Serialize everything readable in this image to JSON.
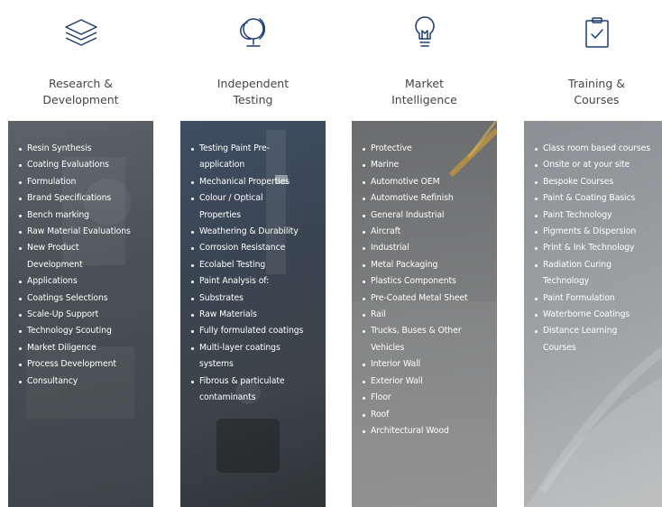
{
  "columns": [
    {
      "icon": "layers-icon",
      "title_line1": "Research &",
      "title_line2": "Development",
      "items": [
        [
          "Resin Synthesis"
        ],
        [
          "Coating Evaluations"
        ],
        [
          "Formulation"
        ],
        [
          "Brand Specifications"
        ],
        [
          "Bench marking"
        ],
        [
          "Raw Material Evaluations"
        ],
        [
          "New Product",
          "Development"
        ],
        [
          "Applications"
        ],
        [
          "Coatings Selections"
        ],
        [
          "Scale-Up Support"
        ],
        [
          "Technology Scouting"
        ],
        [
          "Market Diligence"
        ],
        [
          "Process Development"
        ],
        [
          "Consultancy"
        ]
      ]
    },
    {
      "icon": "globe-icon",
      "title_line1": "Independent",
      "title_line2": "Testing",
      "items": [
        [
          "Testing Paint Pre-",
          "application"
        ],
        [
          "Mechanical Properties"
        ],
        [
          "Colour / Optical",
          "Properties"
        ],
        [
          "Weathering & Durability"
        ],
        [
          "Corrosion Resistance"
        ],
        [
          "Ecolabel Testing"
        ],
        [
          "Paint Analysis of:"
        ],
        [
          "Substrates"
        ],
        [
          "Raw Materials"
        ],
        [
          "Fully formulated coatings"
        ],
        [
          "Multi-layer coatings",
          "systems"
        ],
        [
          "Fibrous & particulate",
          "contaminants"
        ]
      ]
    },
    {
      "icon": "lightbulb-icon",
      "title_line1": "Market",
      "title_line2": "Intelligence",
      "items": [
        [
          "Protective"
        ],
        [
          "Marine"
        ],
        [
          "Automotive OEM"
        ],
        [
          "Automotive Refinish"
        ],
        [
          "General Industrial"
        ],
        [
          "Aircraft"
        ],
        [
          "Industrial"
        ],
        [
          "Metal Packaging"
        ],
        [
          "Plastics Components"
        ],
        [
          "Pre-Coated Metal Sheet"
        ],
        [
          "Rail"
        ],
        [
          "Trucks, Buses & Other",
          "Vehicles"
        ],
        [
          "Interior Wall"
        ],
        [
          "Exterior Wall"
        ],
        [
          "Floor"
        ],
        [
          "Roof"
        ],
        [
          "Architectural Wood"
        ]
      ]
    },
    {
      "icon": "clipboard-check-icon",
      "title_line1": "Training &",
      "title_line2": "Courses",
      "items": [
        [
          "Class room based courses"
        ],
        [
          "Onsite or at your site"
        ],
        [
          "Bespoke Courses"
        ],
        [
          "Paint & Coating Basics"
        ],
        [
          "Paint Technology"
        ],
        [
          "Pigments & Dispersion"
        ],
        [
          "Print & Ink Technology"
        ],
        [
          "Radiation Curing",
          "Technology"
        ],
        [
          "Paint Formulation"
        ],
        [
          "Waterborne Coatings"
        ],
        [
          "Distance Learning",
          "Courses"
        ]
      ]
    }
  ],
  "colors": {
    "icon_stroke": "#1f3b6e",
    "heading_text": "#444444",
    "list_text": "#ffffff"
  }
}
